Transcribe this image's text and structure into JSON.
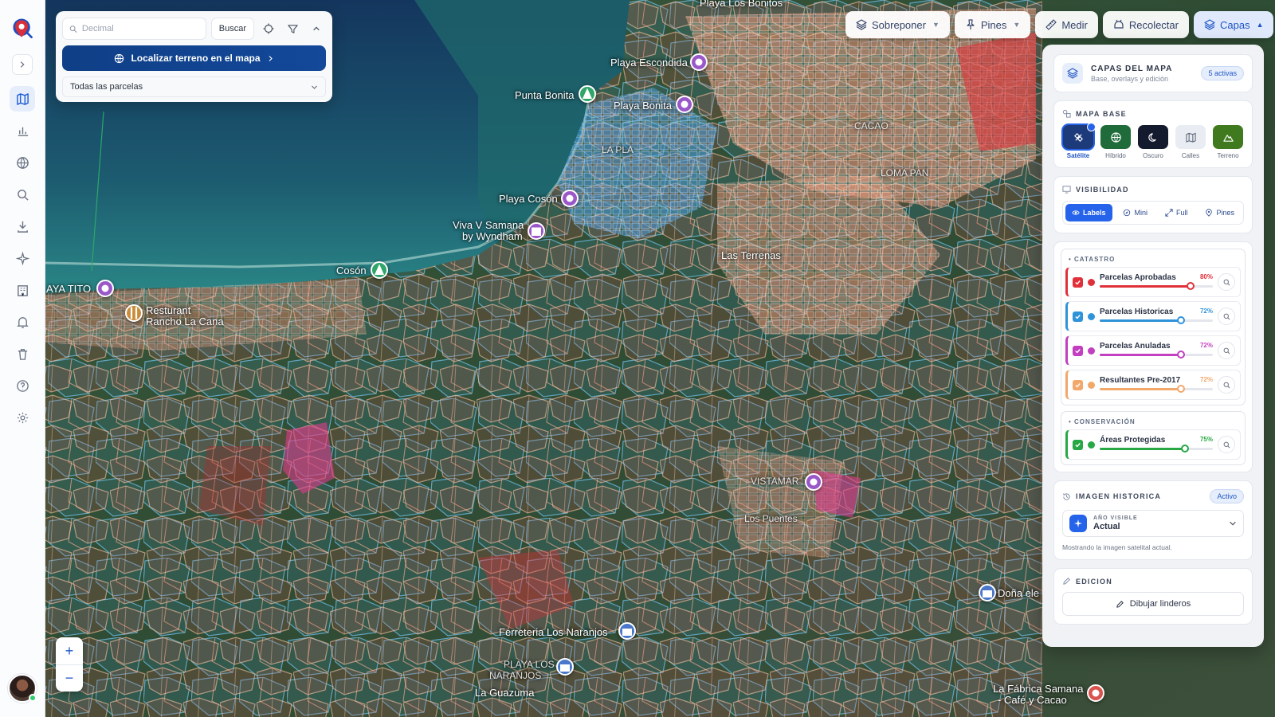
{
  "search": {
    "placeholder": "Decimal",
    "search_label": "Buscar",
    "locate_label": "Localizar terreno en el mapa",
    "filter_value": "Todas las parcelas"
  },
  "toolbar": {
    "overlay_label": "Sobreponer",
    "pins_label": "Pines",
    "measure_label": "Medir",
    "collect_label": "Recolectar",
    "layers_label": "Capas"
  },
  "layers_panel": {
    "title": "CAPAS DEL MAPA",
    "subtitle": "Base, overlays y edición",
    "active_badge": "5 activas",
    "base_map": {
      "title": "MAPA BASE",
      "options": [
        {
          "label": "Satélite",
          "color": "#1d3a7a",
          "icon": "satellite-icon"
        },
        {
          "label": "Híbrido",
          "color": "#1f6b3a",
          "icon": "globe-icon"
        },
        {
          "label": "Oscuro",
          "color": "#151b2e",
          "icon": "moon-icon"
        },
        {
          "label": "Calles",
          "color": "#e9ecf2",
          "icon": "map-icon"
        },
        {
          "label": "Terreno",
          "color": "#3f7a1f",
          "icon": "mountain-icon"
        }
      ]
    },
    "visibility": {
      "title": "VISIBILIDAD",
      "options": [
        {
          "label": "Labels",
          "icon": "eye-icon"
        },
        {
          "label": "Mini",
          "icon": "compass-icon"
        },
        {
          "label": "Full",
          "icon": "expand-icon"
        },
        {
          "label": "Pines",
          "icon": "pin-icon"
        }
      ]
    },
    "cadastre": {
      "title": "CATASTRO",
      "layers": [
        {
          "name": "Parcelas Aprobadas",
          "percent": "80%",
          "value": 0.8,
          "color": "#e0313a"
        },
        {
          "name": "Parcelas Historicas",
          "percent": "72%",
          "value": 0.72,
          "color": "#2f93d9"
        },
        {
          "name": "Parcelas Anuladas",
          "percent": "72%",
          "value": 0.72,
          "color": "#c23fc0"
        },
        {
          "name": "Resultantes Pre-2017",
          "percent": "72%",
          "value": 0.72,
          "color": "#f2a86b"
        }
      ]
    },
    "conservation": {
      "title": "CONSERVACIÓN",
      "layers": [
        {
          "name": "Áreas Protegidas",
          "percent": "75%",
          "value": 0.75,
          "color": "#28a745"
        }
      ]
    },
    "historic": {
      "title": "IMAGEN HISTORICA",
      "badge": "Activo",
      "year_label": "AÑO VISIBLE",
      "year_value": "Actual",
      "hint": "Mostrando la imagen satelital actual."
    },
    "edit": {
      "title": "EDICION",
      "draw_label": "Dibujar linderos"
    }
  },
  "map_labels": {
    "playa_los_bonitos": "Playa Los Bonitos",
    "playa_escondida": "Playa Escondida",
    "punta_bonita": "Punta Bonita",
    "playa_bonita": "Playa Bonita",
    "playa_coson": "Playa Cosón",
    "viva_samana": "Viva V Samana",
    "by_wyndham": "by Wyndham",
    "coson": "Cosón",
    "playa_tito": "AYA TITO",
    "restaurant_1": "Resturant",
    "restaurant_2": "Rancho La Cana",
    "las_terrenas": "Las Terrenas",
    "vistamar": "VISTAMAR",
    "los_puentes": "Los Puentes",
    "ferreteria": "Ferreteria Los Naranjos",
    "playa_los_1": "PLAYA LOS",
    "playa_los_2": "NARANJOS",
    "la_guazuma": "La Guazuma",
    "dona_elena": "Doña ele",
    "fabrica_1": "La Fábrica Samana",
    "fabrica_2": "- Café y Cacao",
    "loma_pan": "LOMA PAN",
    "cacao": "CACAO",
    "la_playa": "LA PLA"
  }
}
